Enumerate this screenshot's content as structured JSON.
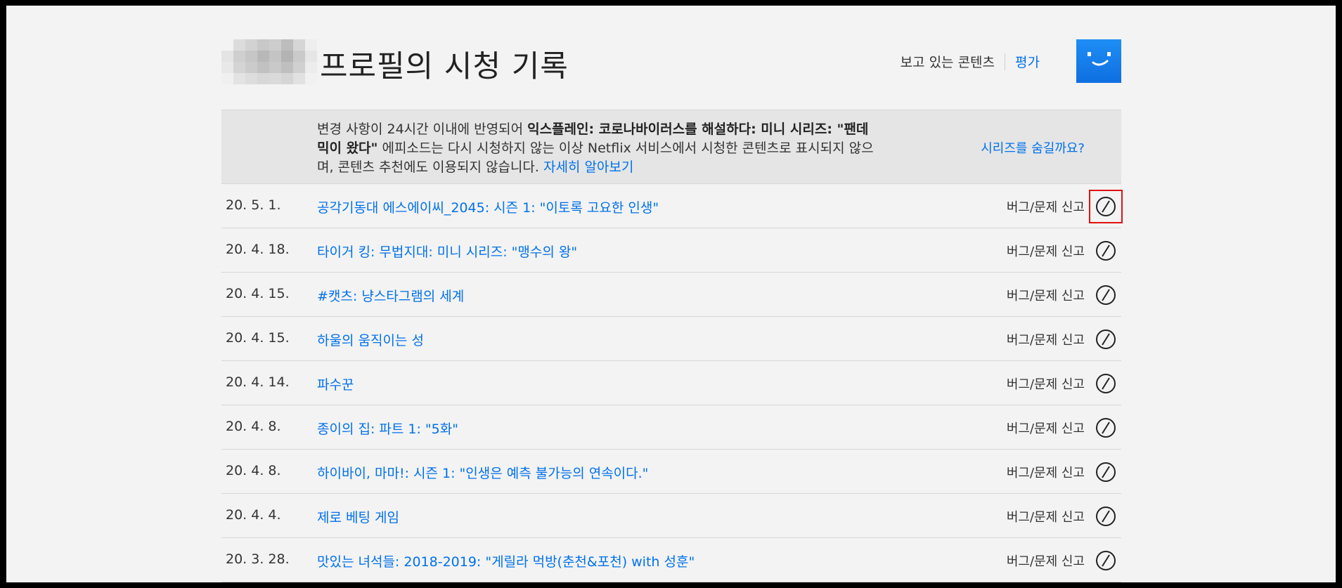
{
  "header": {
    "title": "프로필의 시청 기록",
    "nav_watching": "보고 있는 콘텐츠",
    "nav_ratings": "평가",
    "avatar_icon": "smiley-face-icon",
    "avatar_color": "#1a82f0"
  },
  "notice": {
    "text_prefix": "변경 사항이 24시간 이내에 반영되어 ",
    "text_bold": "익스플레인: 코로나바이러스를 해설하다: 미니 시리즈: \"팬데믹이 왔다\"",
    "text_suffix": " 에피소드는 다시 시청하지 않는 이상 Netflix 서비스에서 시청한 콘텐츠로 표시되지 않으며, 콘텐츠 추천에도 이용되지 않습니다. ",
    "learn_more": "자세히 알아보기",
    "hide_series": "시리즈를 숨길까요?"
  },
  "colors": {
    "link": "#0071eb",
    "highlight": "#e11111"
  },
  "history": [
    {
      "date": "20. 5. 1.",
      "title": "공각기동대 에스에이씨_2045: 시즌 1: \"이토록 고요한 인생\"",
      "report": "버그/문제 신고",
      "hide_icon": "hide-from-history-icon",
      "highlighted": true
    },
    {
      "date": "20. 4. 18.",
      "title": "타이거 킹: 무법지대: 미니 시리즈: \"맹수의 왕\"",
      "report": "버그/문제 신고",
      "hide_icon": "hide-from-history-icon"
    },
    {
      "date": "20. 4. 15.",
      "title": "#캣츠: 냥스타그램의 세계",
      "report": "버그/문제 신고",
      "hide_icon": "hide-from-history-icon"
    },
    {
      "date": "20. 4. 15.",
      "title": "하울의 움직이는 성",
      "report": "버그/문제 신고",
      "hide_icon": "hide-from-history-icon"
    },
    {
      "date": "20. 4. 14.",
      "title": "파수꾼",
      "report": "버그/문제 신고",
      "hide_icon": "hide-from-history-icon"
    },
    {
      "date": "20. 4. 8.",
      "title": "종이의 집: 파트 1: \"5화\"",
      "report": "버그/문제 신고",
      "hide_icon": "hide-from-history-icon"
    },
    {
      "date": "20. 4. 8.",
      "title": "하이바이, 마마!: 시즌 1: \"인생은 예측 불가능의 연속이다.\"",
      "report": "버그/문제 신고",
      "hide_icon": "hide-from-history-icon"
    },
    {
      "date": "20. 4. 4.",
      "title": "제로 베팅 게임",
      "report": "버그/문제 신고",
      "hide_icon": "hide-from-history-icon"
    },
    {
      "date": "20. 3. 28.",
      "title": "맛있는 녀석들: 2018-2019: \"게릴라 먹방(춘천&포천) with 성훈\"",
      "report": "버그/문제 신고",
      "hide_icon": "hide-from-history-icon"
    }
  ]
}
